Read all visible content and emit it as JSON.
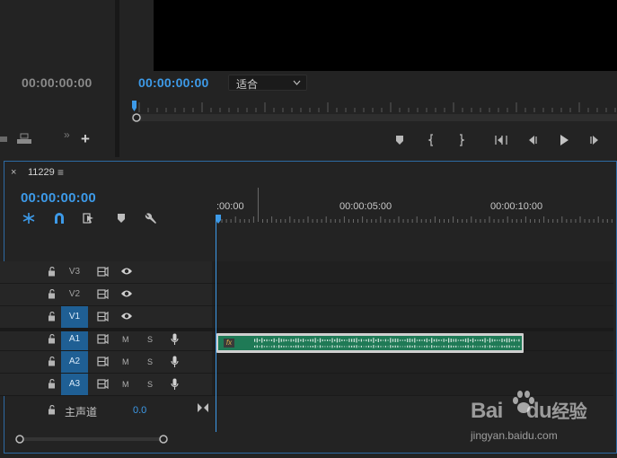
{
  "source_monitor": {
    "timecode": "00:00:00:00"
  },
  "program_monitor": {
    "timecode": "00:00:00:00",
    "fit_select": {
      "selected": "适合"
    }
  },
  "program_controls": [
    {
      "name": "add-marker-button",
      "icon": "marker-icon"
    },
    {
      "name": "mark-in-button",
      "icon": "mark-in-icon"
    },
    {
      "name": "mark-out-button",
      "icon": "mark-out-icon"
    },
    {
      "name": "go-to-in-button",
      "icon": "go-to-in-icon"
    },
    {
      "name": "step-back-button",
      "icon": "step-back-icon"
    },
    {
      "name": "play-button",
      "icon": "play-icon"
    },
    {
      "name": "step-forward-button",
      "icon": "step-forward-icon"
    }
  ],
  "timeline": {
    "close_glyph": "×",
    "sequence_name": "11229",
    "menu_glyph": "≡",
    "timecode": "00:00:00:00",
    "ruler_labels": [
      ":00:00",
      "00:00:05:00",
      "00:00:10:00"
    ],
    "video_tracks": [
      {
        "name": "V3",
        "active": false
      },
      {
        "name": "V2",
        "active": false
      },
      {
        "name": "V1",
        "active": true
      }
    ],
    "audio_tracks": [
      {
        "name": "A1",
        "active": true,
        "m": "M",
        "s": "S"
      },
      {
        "name": "A2",
        "active": true,
        "m": "M",
        "s": "S"
      },
      {
        "name": "A3",
        "active": true,
        "m": "M",
        "s": "S"
      }
    ],
    "master": {
      "label": "主声道",
      "value": "0.0"
    },
    "clip": {
      "badge": "fx"
    }
  },
  "watermark": {
    "brand": "Bai",
    "brand2": "du",
    "suffix": "经验",
    "url": "jingyan.baidu.com"
  },
  "colors": {
    "accent": "#3d9ae8",
    "clip": "#1f7a56",
    "track_active": "#1f5f94",
    "border": "#2d6aa3"
  }
}
